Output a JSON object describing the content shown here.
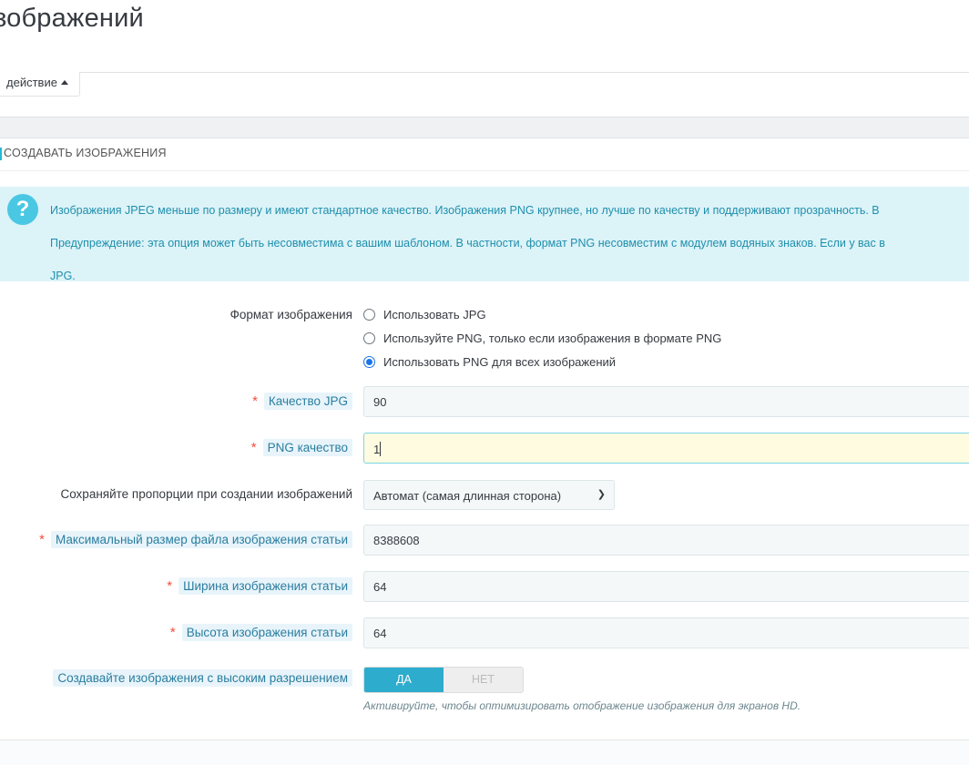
{
  "header": {
    "title": "зображений",
    "action_button": "действие"
  },
  "panel": {
    "title": "Создавать изображения"
  },
  "alert": {
    "icon": "question-circle-icon",
    "line1": "Изображения JPEG меньше по размеру и имеют стандартное качество. Изображения PNG крупнее, но лучше по качеству и поддерживают прозрачность. В",
    "line2": "Предупреждение: эта опция может быть несовместима с вашим шаблоном. В частности, формат PNG несовместим с модулем водяных знаков. Если у вас в",
    "line3": "JPG."
  },
  "form": {
    "format": {
      "label": "Формат изображения",
      "options": [
        "Использовать JPG",
        "Используйте PNG, только если изображения в формате PNG",
        "Использовать PNG для всех изображений"
      ],
      "selected": 2
    },
    "jpg_quality": {
      "label": "Качество JPG",
      "value": "90"
    },
    "png_quality": {
      "label": "PNG качество",
      "value": "1"
    },
    "proportions": {
      "label": "Сохраняйте пропорции при создании изображений",
      "value": "Автомат (самая длинная сторона)"
    },
    "max_size": {
      "label": "Максимальный размер файла изображения статьи",
      "value": "8388608"
    },
    "width": {
      "label": "Ширина изображения статьи",
      "value": "64"
    },
    "height": {
      "label": "Высота изображения статьи",
      "value": "64"
    },
    "hires": {
      "label": "Создавайте изображения с высоким разрешением",
      "yes": "ДА",
      "no": "НЕТ",
      "value": true,
      "hint": "Активируйте, чтобы оптимизировать отображение изображения для экранов HD."
    }
  },
  "colors": {
    "accent": "#25b9d7",
    "toggle_on": "#2eacce",
    "alert_bg": "#dcf3f8",
    "required": "#f54c3e"
  }
}
